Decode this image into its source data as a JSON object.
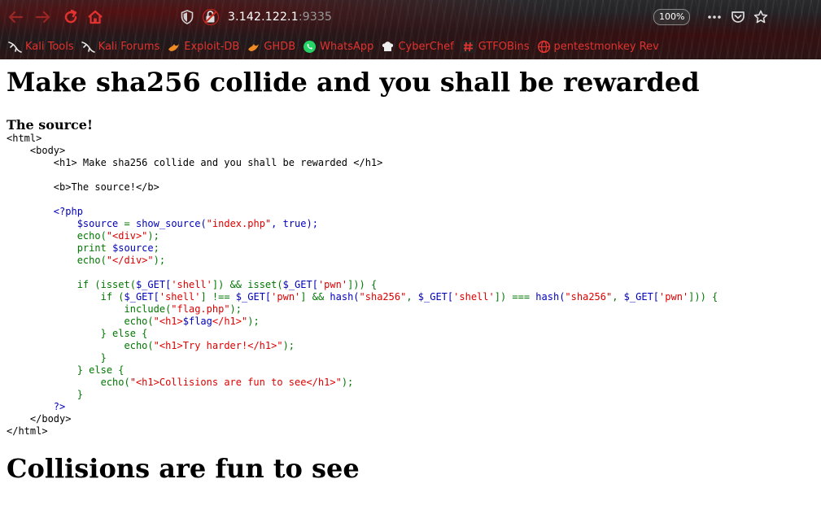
{
  "browser": {
    "url_host": "3.142.122.1",
    "url_port": ":9335",
    "zoom": "100%",
    "bookmarks": [
      {
        "label": "Kali Tools",
        "icon": "kali-dragon-icon"
      },
      {
        "label": "Kali Forums",
        "icon": "kali-dragon-icon"
      },
      {
        "label": "Exploit-DB",
        "icon": "exploit-db-icon"
      },
      {
        "label": "GHDB",
        "icon": "ghdb-icon"
      },
      {
        "label": "WhatsApp",
        "icon": "whatsapp-icon"
      },
      {
        "label": "CyberChef",
        "icon": "cyberchef-icon"
      },
      {
        "label": "GTFOBins",
        "icon": "gtfobins-icon"
      },
      {
        "label": "pentestmonkey Rev",
        "icon": "globe-icon"
      }
    ],
    "colors": {
      "bookmark_text": "#e0332f",
      "nav_icon": "#e0332f"
    }
  },
  "page": {
    "title": "Make sha256 collide and you shall be rewarded",
    "source_label": "The source!",
    "code": {
      "l1": "<html>",
      "l2": "    <body>",
      "l3": "        <h1> Make sha256 collide and you shall be rewarded </h1>",
      "l4": "",
      "l5": "        <b>The source!</b>",
      "l6": "",
      "l7_open": "        <?php",
      "l8_var": "$source",
      "l8_eq": " = ",
      "l8_fn": "show_source(",
      "l8_str": "\"index.php\"",
      "l8_rest": ", true);",
      "l9_kw": "echo(",
      "l9_str": "\"<div>\"",
      "l9_end": ");",
      "l10_kw": "print ",
      "l10_var": "$source",
      "l10_end": ";",
      "l11_kw": "echo(",
      "l11_str": "\"</div>\"",
      "l11_end": ");",
      "l13_a": "if (isset(",
      "l13_b": "$_GET[",
      "l13_c": "'shell'",
      "l13_d": "]) && isset(",
      "l13_e": "$_GET[",
      "l13_f": "'pwn'",
      "l13_g": "])) {",
      "l14_a": "if (",
      "l14_b": "$_GET[",
      "l14_c": "'shell'",
      "l14_d": "] !== ",
      "l14_e": "$_GET[",
      "l14_f": "'pwn'",
      "l14_g": "] && ",
      "l14_h": "hash(",
      "l14_i": "\"sha256\"",
      "l14_j": ", ",
      "l14_k": "$_GET[",
      "l14_l": "'shell'",
      "l14_m": "]) === ",
      "l14_n": "hash(",
      "l14_o": "\"sha256\"",
      "l14_p": ", ",
      "l14_q": "$_GET[",
      "l14_r": "'pwn'",
      "l14_s": "])) {",
      "l15_kw": "include(",
      "l15_str": "\"flag.php\"",
      "l15_end": ");",
      "l16_kw": "echo(",
      "l16_str1": "\"<h1>",
      "l16_var": "$flag",
      "l16_str2": "</h1>\"",
      "l16_end": ");",
      "l17": "} else {",
      "l18_kw": "echo(",
      "l18_str": "\"<h1>Try harder!</h1>\"",
      "l18_end": ");",
      "l19": "}",
      "l20": "} else {",
      "l21_kw": "echo(",
      "l21_str": "\"<h1>Collisions are fun to see</h1>\"",
      "l21_end": ");",
      "l22": "}",
      "l23": "?>",
      "l24": "    </body>",
      "l25": "</html>"
    },
    "result": "Collisions are fun to see"
  }
}
